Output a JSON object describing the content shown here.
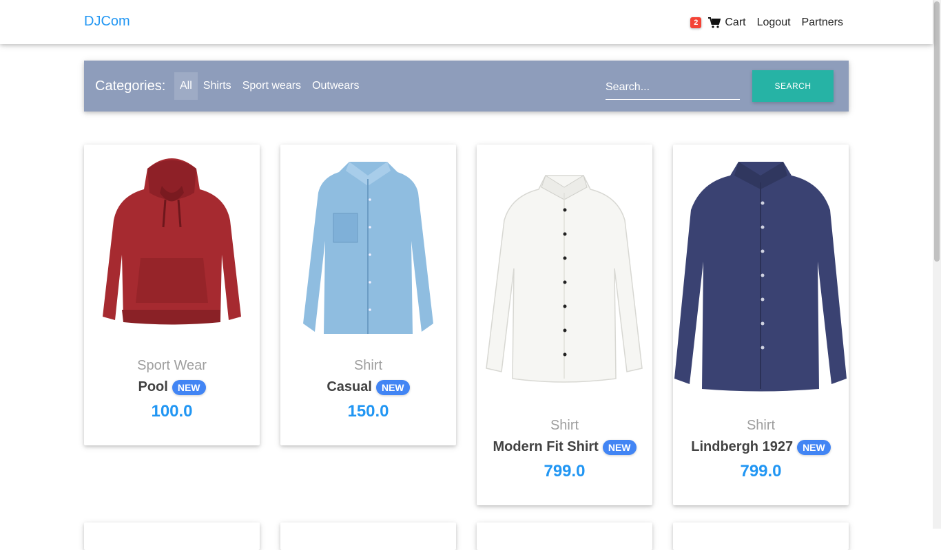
{
  "navbar": {
    "brand": "DJCom",
    "cart_count": "2",
    "cart_label": "Cart",
    "logout_label": "Logout",
    "partners_label": "Partners"
  },
  "categories": {
    "title": "Categories:",
    "items": [
      "All",
      "Shirts",
      "Sport wears",
      "Outwears"
    ],
    "search_placeholder": "Search...",
    "search_button": "SEARCH"
  },
  "products": [
    {
      "category": "Sport Wear",
      "name": "Pool",
      "badge": "NEW",
      "price": "100.0",
      "image": "red-hoodie"
    },
    {
      "category": "Shirt",
      "name": "Casual",
      "badge": "NEW",
      "price": "150.0",
      "image": "denim-shirt"
    },
    {
      "category": "Shirt",
      "name": "Modern Fit Shirt",
      "badge": "NEW",
      "price": "799.0",
      "image": "white-shirt"
    },
    {
      "category": "Shirt",
      "name": "Lindbergh 1927",
      "badge": "NEW",
      "price": "799.0",
      "image": "navy-shirt"
    }
  ],
  "colors": {
    "brand": "#2196f3",
    "catbar": "#8e9dbb",
    "search_button": "#26b3a5",
    "badge": "#4285f4",
    "cart_badge": "#f44336"
  }
}
